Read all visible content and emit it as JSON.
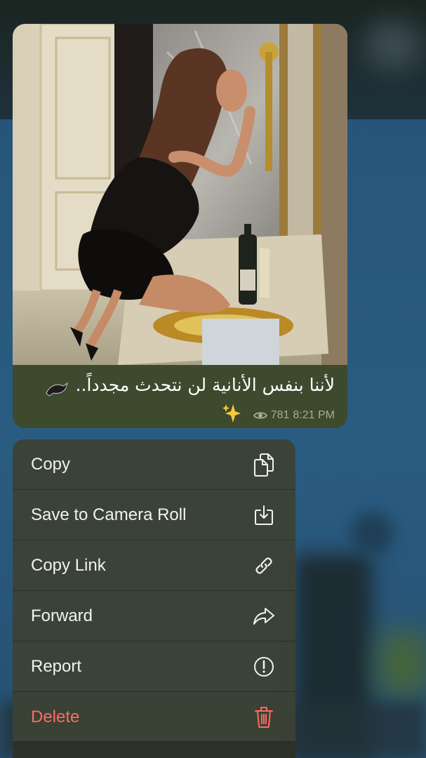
{
  "message": {
    "caption": "لأننا بنفس الأنانية لن نتحدث مجدداً..",
    "views": "781",
    "time": "8:21 PM"
  },
  "menu": {
    "items": [
      {
        "label": "Copy",
        "icon": "copy-icon"
      },
      {
        "label": "Save to Camera Roll",
        "icon": "save-download-icon"
      },
      {
        "label": "Copy Link",
        "icon": "link-icon"
      },
      {
        "label": "Forward",
        "icon": "forward-arrow-icon"
      },
      {
        "label": "Report",
        "icon": "exclamation-circle-icon"
      },
      {
        "label": "Delete",
        "icon": "trash-icon",
        "danger": true
      }
    ]
  },
  "colors": {
    "bubble": "#3d4a2e",
    "menu": "#3c4234",
    "delete": "#ff6b61",
    "backdrop_blue": "#2a5c82"
  }
}
